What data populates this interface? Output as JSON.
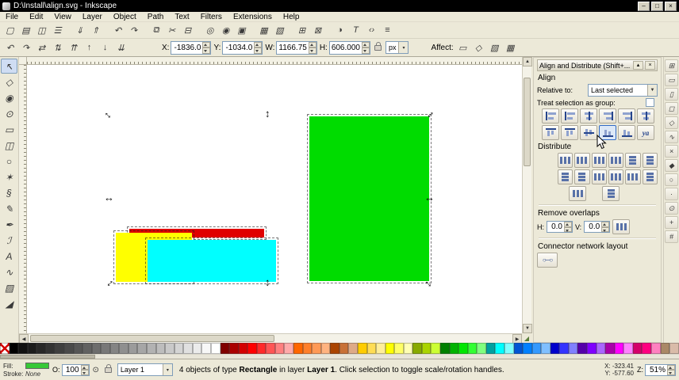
{
  "titlebar": {
    "title": "D:\\Install\\align.svg - Inkscape",
    "minimize": "–",
    "maximize": "□",
    "close": "×"
  },
  "menus": [
    "File",
    "Edit",
    "View",
    "Layer",
    "Object",
    "Path",
    "Text",
    "Filters",
    "Extensions",
    "Help"
  ],
  "command_toolbar": [
    {
      "n": "new-button",
      "i": "new-document-icon",
      "g": "▢"
    },
    {
      "n": "open-button",
      "i": "open-folder-icon",
      "g": "▤"
    },
    {
      "n": "save-button",
      "i": "save-icon",
      "g": "◫"
    },
    {
      "n": "print-button",
      "i": "print-icon",
      "g": "☰"
    },
    {
      "n": "import-button",
      "i": "import-icon",
      "g": "⇓"
    },
    {
      "n": "export-button",
      "i": "export-icon",
      "g": "⇑"
    },
    {
      "n": "undo-button",
      "i": "undo-icon",
      "g": "↶"
    },
    {
      "n": "redo-button",
      "i": "redo-icon",
      "g": "↷"
    },
    {
      "n": "copy-button",
      "i": "copy-icon",
      "g": "⧉"
    },
    {
      "n": "cut-button",
      "i": "scissors-icon",
      "g": "✂"
    },
    {
      "n": "paste-button",
      "i": "paste-icon",
      "g": "⊟"
    },
    {
      "n": "zoom-drawing-button",
      "i": "zoom-drawing-icon",
      "g": "◎"
    },
    {
      "n": "zoom-selection-button",
      "i": "zoom-selection-icon",
      "g": "◉"
    },
    {
      "n": "zoom-page-button",
      "i": "zoom-page-icon",
      "g": "▣"
    },
    {
      "n": "duplicate-button",
      "i": "duplicate-icon",
      "g": "▦"
    },
    {
      "n": "clone-button",
      "i": "clone-icon",
      "g": "▧"
    },
    {
      "n": "group-button",
      "i": "group-icon",
      "g": "⊞"
    },
    {
      "n": "ungroup-button",
      "i": "ungroup-icon",
      "g": "⊠"
    },
    {
      "n": "fill-stroke-button",
      "i": "fill-stroke-icon",
      "g": "◑"
    },
    {
      "n": "text-dialog-button",
      "i": "text-icon",
      "g": "T"
    },
    {
      "n": "xml-editor-button",
      "i": "xml-editor-icon",
      "g": "‹›"
    },
    {
      "n": "align-dialog-button",
      "i": "align-dialog-icon",
      "g": "≡"
    }
  ],
  "tool_options": {
    "buttons": [
      {
        "n": "rotate-ccw-button",
        "i": "rotate-ccw-icon",
        "g": "↶"
      },
      {
        "n": "rotate-cw-button",
        "i": "rotate-cw-icon",
        "g": "↷"
      },
      {
        "n": "flip-horizontal-button",
        "i": "flip-horizontal-icon",
        "g": "⇄"
      },
      {
        "n": "flip-vertical-button",
        "i": "flip-vertical-icon",
        "g": "⇅"
      },
      {
        "n": "raise-to-top-button",
        "i": "raise-top-icon",
        "g": "⇈"
      },
      {
        "n": "raise-button",
        "i": "raise-icon",
        "g": "↑"
      },
      {
        "n": "lower-button",
        "i": "lower-icon",
        "g": "↓"
      },
      {
        "n": "lower-to-bottom-button",
        "i": "lower-bottom-icon",
        "g": "⇊"
      }
    ],
    "fields": [
      {
        "n": "x-input",
        "l": "X:",
        "v": "-1836.0"
      },
      {
        "n": "y-input",
        "l": "Y:",
        "v": "-1034.0"
      },
      {
        "n": "w-input",
        "l": "W:",
        "v": "1166.75"
      },
      {
        "n": "h-input",
        "l": "H:",
        "v": "606.000"
      }
    ],
    "units": "px",
    "units_chevron": "▾",
    "affect_label": "Affect:",
    "affect_buttons": [
      {
        "n": "affect-stroke-button",
        "i": "affect-stroke-icon",
        "g": "▭"
      },
      {
        "n": "affect-corners-button",
        "i": "affect-corners-icon",
        "g": "◇"
      },
      {
        "n": "affect-gradients-button",
        "i": "affect-gradients-icon",
        "g": "▧"
      },
      {
        "n": "affect-patterns-button",
        "i": "affect-patterns-icon",
        "g": "▦"
      }
    ]
  },
  "toolbox": [
    {
      "n": "selector-tool-button",
      "i": "selector-tool-icon",
      "g": "↖"
    },
    {
      "n": "node-tool-button",
      "i": "node-tool-icon",
      "g": "◇"
    },
    {
      "n": "tweak-tool-button",
      "i": "tweak-tool-icon",
      "g": "◉"
    },
    {
      "n": "zoom-tool-button",
      "i": "zoom-tool-icon",
      "g": "⊙"
    },
    {
      "n": "rectangle-tool-button",
      "i": "rectangle-tool-icon",
      "g": "▭"
    },
    {
      "n": "box3d-tool-button",
      "i": "box3d-tool-icon",
      "g": "◫"
    },
    {
      "n": "ellipse-tool-button",
      "i": "ellipse-tool-icon",
      "g": "○"
    },
    {
      "n": "star-tool-button",
      "i": "star-tool-icon",
      "g": "✶"
    },
    {
      "n": "spiral-tool-button",
      "i": "spiral-tool-icon",
      "g": "§"
    },
    {
      "n": "pencil-tool-button",
      "i": "pencil-tool-icon",
      "g": "✎"
    },
    {
      "n": "pen-tool-button",
      "i": "pen-tool-icon",
      "g": "✒"
    },
    {
      "n": "calligraphy-tool-button",
      "i": "calligraphy-tool-icon",
      "g": "ℐ"
    },
    {
      "n": "text-tool-button",
      "i": "text-tool-icon",
      "g": "A"
    },
    {
      "n": "connector-tool-button",
      "i": "connector-tool-icon",
      "g": "∿"
    },
    {
      "n": "gradient-tool-button",
      "i": "gradient-tool-icon",
      "g": "▨"
    },
    {
      "n": "dropper-tool-button",
      "i": "dropper-tool-icon",
      "g": "◢"
    }
  ],
  "snapbar": [
    {
      "n": "snap-toggle-button",
      "i": "snap-icon",
      "g": "⊞"
    },
    {
      "n": "snap-bbox-button",
      "i": "snap-bbox-icon",
      "g": "▭"
    },
    {
      "n": "snap-bbox-edges-button",
      "i": "snap-bbox-edge-icon",
      "g": "▯"
    },
    {
      "n": "snap-bbox-corners-button",
      "i": "snap-bbox-corner-icon",
      "g": "◻"
    },
    {
      "n": "snap-nodes-button",
      "i": "snap-nodes-icon",
      "g": "◇"
    },
    {
      "n": "snap-paths-button",
      "i": "snap-path-icon",
      "g": "∿"
    },
    {
      "n": "snap-intersections-button",
      "i": "snap-intersection-icon",
      "g": "×"
    },
    {
      "n": "snap-cusp-nodes-button",
      "i": "snap-cusp-icon",
      "g": "◆"
    },
    {
      "n": "snap-smooth-nodes-button",
      "i": "snap-smooth-icon",
      "g": "○"
    },
    {
      "n": "snap-midpoints-button",
      "i": "snap-midpoint-icon",
      "g": "·"
    },
    {
      "n": "snap-centers-button",
      "i": "snap-center-icon",
      "g": "⊙"
    },
    {
      "n": "snap-rotation-center-button",
      "i": "snap-rotation-icon",
      "g": "+"
    },
    {
      "n": "snap-grid-button",
      "i": "snap-grid-icon",
      "g": "#"
    }
  ],
  "align_panel": {
    "title": "Align and Distribute (Shift+...",
    "shade_icon": "▴",
    "close_icon": "×",
    "align_label": "Align",
    "relative_to_label": "Relative to:",
    "relative_to_value": "Last selected",
    "chevron": "▼",
    "treat_group_label": "Treat selection as group:",
    "align_row1": [
      {
        "n": "align-right-to-anchor-left-button",
        "ic": "ih l"
      },
      {
        "n": "align-left-edges-button",
        "ic": "ih l"
      },
      {
        "n": "align-center-vertical-button",
        "ic": "ih c"
      },
      {
        "n": "align-right-edges-button",
        "ic": "ih r"
      },
      {
        "n": "align-left-to-anchor-right-button",
        "ic": "ih r"
      },
      {
        "n": "align-horizontal-node-button",
        "ic": "ih c"
      }
    ],
    "align_row2": [
      {
        "n": "align-bottom-to-anchor-top-button",
        "ic": "iv t"
      },
      {
        "n": "align-top-edges-button",
        "ic": "iv t"
      },
      {
        "n": "align-center-horizontal-button",
        "ic": "iv m"
      },
      {
        "n": "align-bottom-edges-button",
        "ic": "iv b"
      },
      {
        "n": "align-top-to-anchor-bottom-button",
        "ic": "iv b"
      },
      {
        "n": "align-text-baseline-button",
        "ic": "txt",
        "lb": "ya"
      }
    ],
    "distribute_label": "Distribute",
    "distribute_row1": [
      {
        "n": "distribute-left-edges-button",
        "ic": "id h"
      },
      {
        "n": "distribute-centers-horizontal-button",
        "ic": "id h"
      },
      {
        "n": "distribute-right-edges-button",
        "ic": "id h"
      },
      {
        "n": "distribute-horizontal-gaps-button",
        "ic": "id h"
      },
      {
        "n": "distribute-top-edges-button",
        "ic": "id v"
      },
      {
        "n": "distribute-centers-vertical-button",
        "ic": "id v"
      }
    ],
    "distribute_row2": [
      {
        "n": "distribute-bottom-edges-button",
        "ic": "id v"
      },
      {
        "n": "distribute-vertical-gaps-button",
        "ic": "id v"
      },
      {
        "n": "randomize-centers-button",
        "ic": "id h"
      },
      {
        "n": "unclump-button",
        "ic": "id h"
      },
      {
        "n": "distribute-text-horizontal-button",
        "ic": "id h"
      },
      {
        "n": "distribute-text-vertical-button",
        "ic": "id v"
      }
    ],
    "distribute_row3": [
      {
        "n": "arrange-grid-button",
        "ic": "id h"
      },
      {
        "n": "exchange-positions-button",
        "ic": "id v"
      }
    ],
    "remove_overlaps_label": "Remove overlaps",
    "h_label": "H:",
    "h_value": "0.0",
    "v_label": "V:",
    "v_value": "0.0",
    "connector_label": "Connector network layout",
    "connector_button_glyph": "○─○"
  },
  "canvas": {
    "rects": [
      {
        "name": "red-rectangle",
        "color": "#e00000"
      },
      {
        "name": "yellow-rectangle",
        "color": "#ffff00"
      },
      {
        "name": "cyan-rectangle",
        "color": "#00ffff"
      },
      {
        "name": "green-rectangle",
        "color": "#00dc00"
      }
    ],
    "handle_glyph": "↔"
  },
  "scrollbars": {
    "up": "▲",
    "down": "▼",
    "left": "◀",
    "right": "▶",
    "grip": "◢"
  },
  "palette": {
    "colors": [
      "",
      "#000000",
      "#111111",
      "#1c1c1c",
      "#282828",
      "#333333",
      "#3f3f3f",
      "#4a4a4a",
      "#565656",
      "#616161",
      "#6d6d6d",
      "#787878",
      "#848484",
      "#8f8f8f",
      "#9b9b9b",
      "#a6a6a6",
      "#b2b2b2",
      "#bdbdbd",
      "#c9c9c9",
      "#d4d4d4",
      "#e0e0e0",
      "#ebebeb",
      "#f7f7f7",
      "#ffffff",
      "#800000",
      "#aa0000",
      "#d40000",
      "#ff0000",
      "#ff2a2a",
      "#ff5555",
      "#ff8080",
      "#ffaaaa",
      "#ff6600",
      "#ff7f2a",
      "#ff9955",
      "#ffb380",
      "#aa4400",
      "#c87137",
      "#deaa87",
      "#ffcc00",
      "#ffdd55",
      "#ffee99",
      "#ffff00",
      "#ffff66",
      "#ffffb3",
      "#88aa00",
      "#aad400",
      "#ccff33",
      "#008000",
      "#00b300",
      "#00e600",
      "#33ff33",
      "#80ff80",
      "#00a0a0",
      "#00ffff",
      "#80ffff",
      "#0055d4",
      "#0080ff",
      "#3399ff",
      "#80bfff",
      "#0000cc",
      "#3333ff",
      "#8080ff",
      "#5500aa",
      "#8000ff",
      "#aa66ff",
      "#aa00aa",
      "#ff00ff",
      "#ff80ff",
      "#d4006a",
      "#ff0080",
      "#ff80c0",
      "#aa8866",
      "#d9bba9"
    ]
  },
  "statusbar": {
    "fill_label": "Fill:",
    "fill_color": "#37c837",
    "stroke_label": "Stroke:",
    "stroke_value": "None",
    "opacity_label": "O:",
    "opacity_value": "100",
    "layer_name": "Layer 1",
    "layer_chevron": "▾",
    "eye_glyph": "⊙",
    "message_parts": [
      {
        "t": "4 objects",
        "b": "0"
      },
      {
        "t": " of type ",
        "b": "0"
      },
      {
        "t": "Rectangle",
        "b": "1"
      },
      {
        "t": " in layer ",
        "b": "0"
      },
      {
        "t": "Layer 1",
        "b": "1"
      },
      {
        "t": ". Click selection to toggle scale/rotation handles.",
        "b": "0"
      }
    ],
    "x_coord": "X: -323.41",
    "y_coord": "Y: -577.60",
    "zoom_label": "Z:",
    "zoom_value": "51%"
  }
}
